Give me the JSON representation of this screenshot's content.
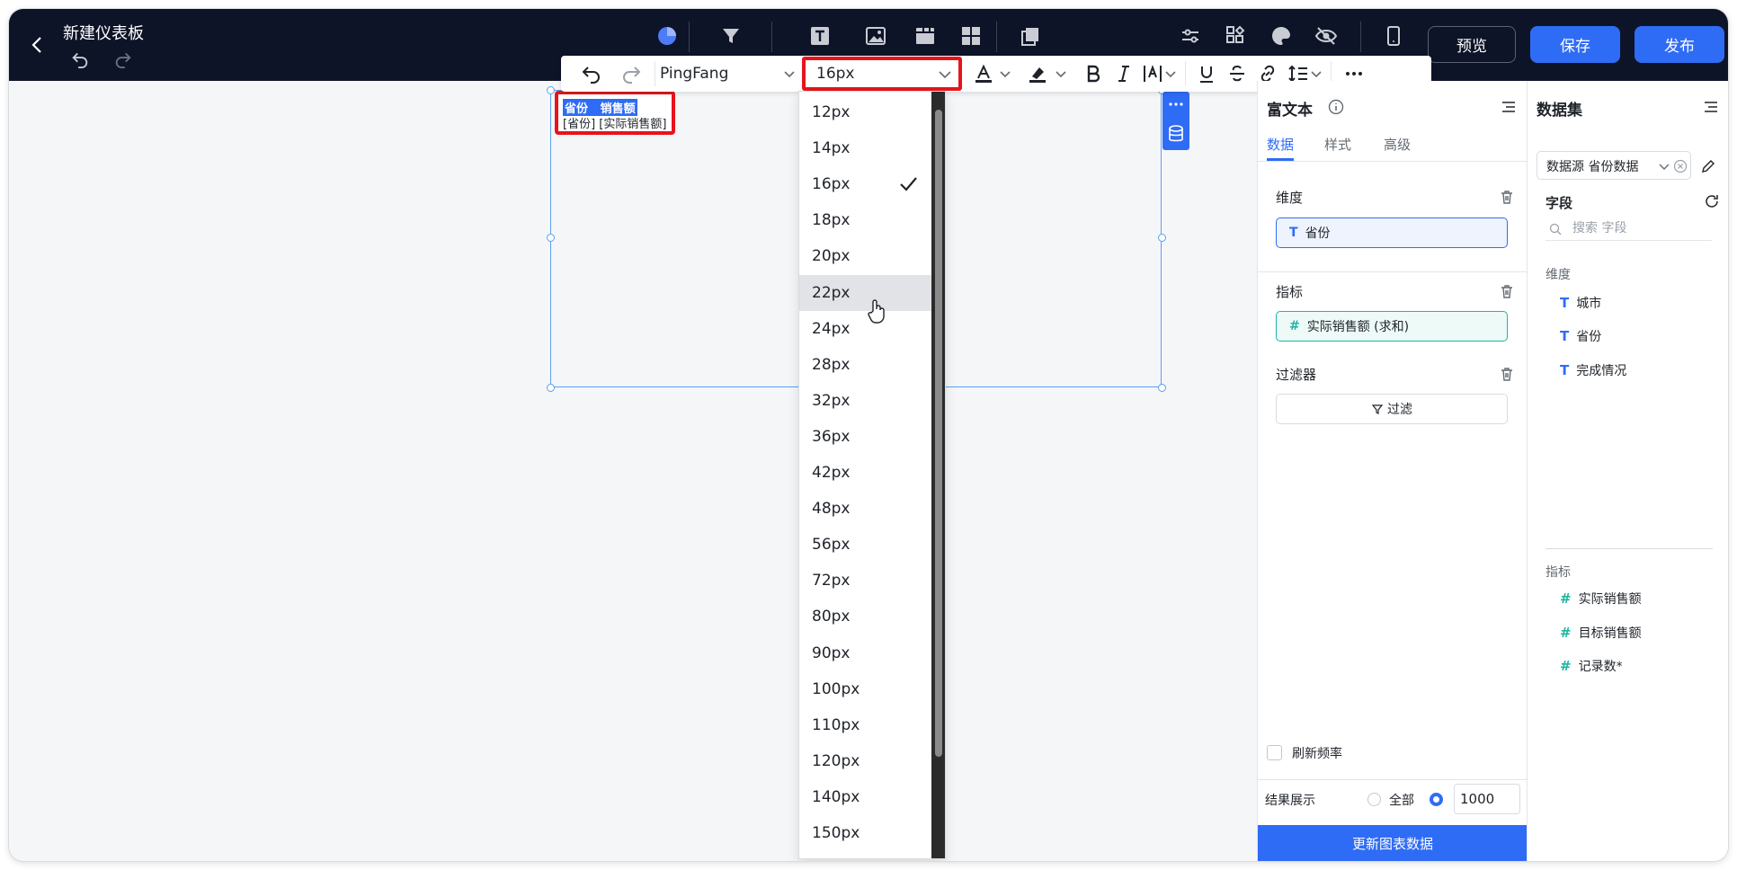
{
  "header": {
    "title": "新建仪表板",
    "preview_label": "预览",
    "save_label": "保存",
    "publish_label": "发布"
  },
  "format_toolbar": {
    "font_family": "PingFang",
    "font_size": "16px"
  },
  "font_size_options": [
    "12px",
    "14px",
    "16px",
    "18px",
    "20px",
    "22px",
    "24px",
    "28px",
    "32px",
    "36px",
    "42px",
    "48px",
    "56px",
    "72px",
    "80px",
    "90px",
    "100px",
    "110px",
    "120px",
    "140px",
    "150px"
  ],
  "font_size_selected": "16px",
  "font_size_hovered": "22px",
  "rich_text": {
    "line1": "省份   销售额",
    "line2": "[省份] [实际销售额]"
  },
  "props_panel": {
    "title": "富文本",
    "tabs": [
      "数据",
      "样式",
      "高级"
    ],
    "active_tab": "数据",
    "dimension_label": "维度",
    "dimension_pill": "省份",
    "measure_label": "指标",
    "measure_pill": "实际销售额 (求和)",
    "filter_label": "过滤器",
    "filter_button": "过滤",
    "refresh_label": "刷新频率",
    "result_label": "结果展示",
    "result_all": "全部",
    "result_limit": "1000",
    "update_button": "更新图表数据"
  },
  "dataset_panel": {
    "title": "数据集",
    "source_select": "数据源 省份数据",
    "fields_label": "字段",
    "search_placeholder": "搜索 字段",
    "dimension_label": "维度",
    "dimensions": [
      "城市",
      "省份",
      "完成情况"
    ],
    "measure_label": "指标",
    "measures": [
      "实际销售额",
      "目标销售额",
      "记录数*"
    ]
  },
  "colors": {
    "accent": "#2f6cf6",
    "topbar": "#0e1427",
    "highlight_red": "#e8141b",
    "measure_teal": "#1fb5a1"
  }
}
